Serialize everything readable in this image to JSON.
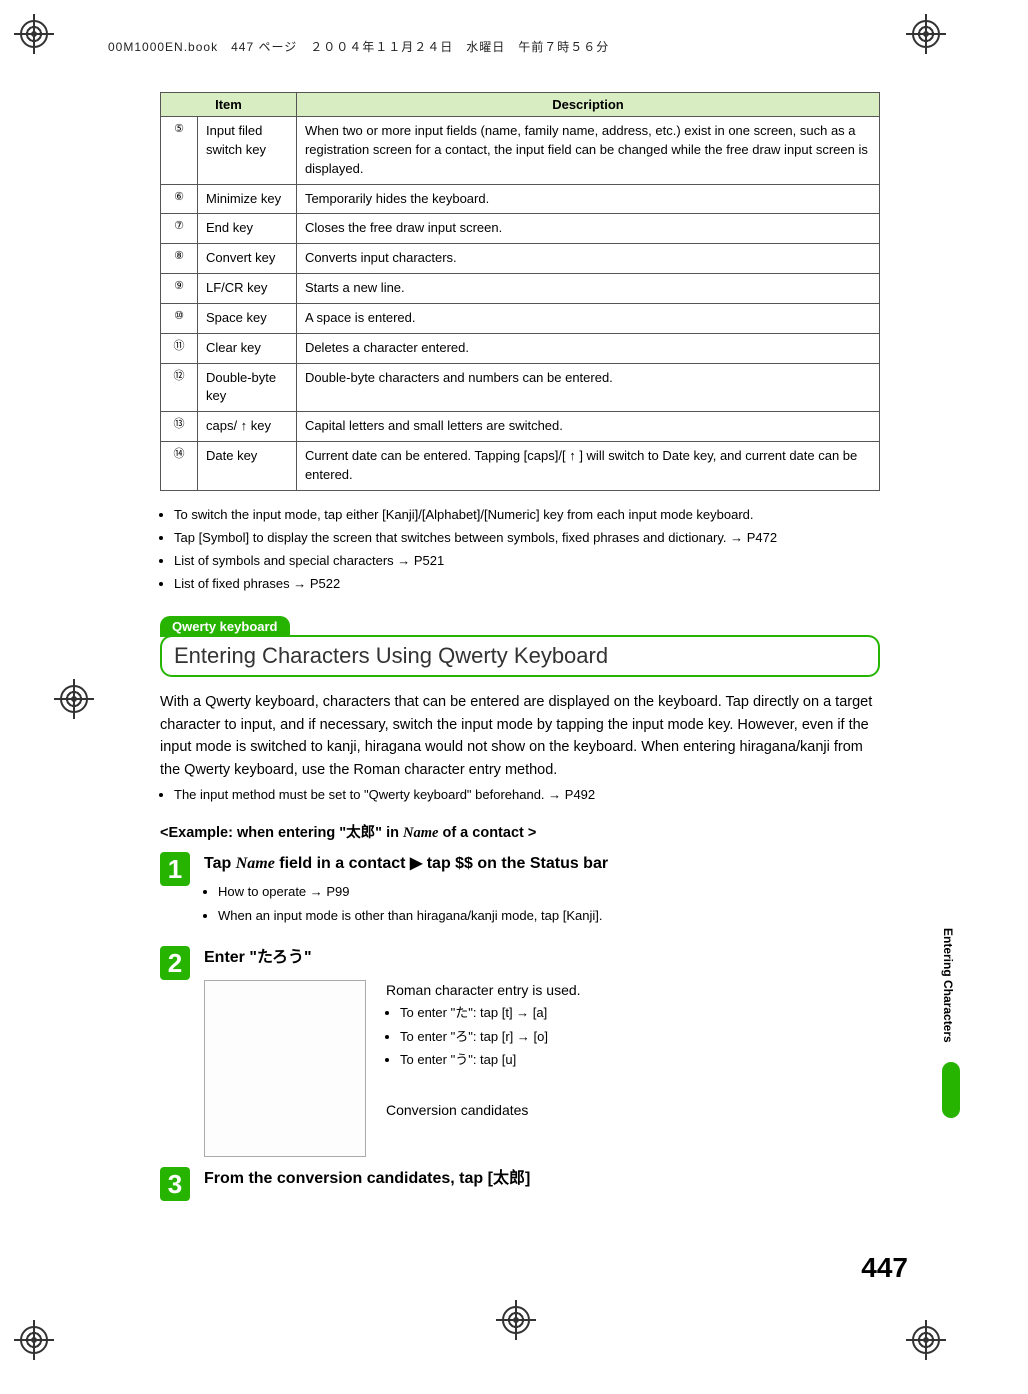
{
  "header": {
    "filename": "00M1000EN.book",
    "page_label": "447 ページ",
    "date": "２００４年１１月２４日",
    "weekday": "水曜日",
    "time": "午前７時５６分"
  },
  "table": {
    "headers": {
      "item": "Item",
      "description": "Description"
    },
    "rows": [
      {
        "num": "⑤",
        "item": "Input filed switch key",
        "desc": "When two or more input fields (name, family name, address, etc.) exist in one screen, such as a registration screen for a contact, the input field can be changed while the free draw input screen is displayed."
      },
      {
        "num": "⑥",
        "item": "Minimize key",
        "desc": "Temporarily hides the keyboard."
      },
      {
        "num": "⑦",
        "item": "End key",
        "desc": "Closes the free draw input screen."
      },
      {
        "num": "⑧",
        "item": "Convert key",
        "desc": "Converts input characters."
      },
      {
        "num": "⑨",
        "item": "LF/CR key",
        "desc": "Starts a new line."
      },
      {
        "num": "⑩",
        "item": "Space key",
        "desc": "A space is entered."
      },
      {
        "num": "⑪",
        "item": "Clear key",
        "desc": "Deletes a character entered."
      },
      {
        "num": "⑫",
        "item": "Double-byte key",
        "desc": "Double-byte characters and numbers can be entered."
      },
      {
        "num": "⑬",
        "item": "caps/ ↑ key",
        "desc": "Capital letters and small letters are switched."
      },
      {
        "num": "⑭",
        "item": "Date key",
        "desc": "Current date can be entered. Tapping [caps]/[ ↑ ] will switch to Date key, and current date can be entered."
      }
    ]
  },
  "notes": [
    "To switch the input mode, tap either [Kanji]/[Alphabet]/[Numeric] key from each input mode keyboard.",
    "Tap [Symbol] to display the screen that switches between symbols, fixed phrases and dictionary. → P472",
    "List of symbols and special characters → P521",
    "List of fixed phrases → P522"
  ],
  "section": {
    "pill": "Qwerty keyboard",
    "title": "Entering Characters Using Qwerty Keyboard",
    "body": "With a Qwerty keyboard, characters that can be entered are displayed on the keyboard. Tap directly on a target character to input, and if necessary, switch the input mode by tapping the input mode key. However, even if the input mode is switched to kanji, hiragana would not show on the keyboard. When entering hiragana/kanji from the Qwerty keyboard, use the Roman character entry method.",
    "precond": "The input method must be set to \"Qwerty keyboard\" beforehand. → P492"
  },
  "example": {
    "heading_prefix": "<Example: when entering \"",
    "heading_kanji": "太郎",
    "heading_mid": "\" in ",
    "heading_name": "Name",
    "heading_suffix": " of a contact >"
  },
  "steps": {
    "s1": {
      "num": "1",
      "title_pre": "Tap ",
      "title_name": "Name",
      "title_mid": " field in a contact ",
      "title_arrow": "▶",
      "title_post": " tap $$ on the Status bar",
      "b1": "How to operate → P99",
      "b2": "When an input mode is other than hiragana/kanji mode, tap [Kanji]."
    },
    "s2": {
      "num": "2",
      "title_pre": "Enter \"",
      "title_kana": "たろう",
      "title_post": "\"",
      "right_intro": "Roman character entry is used.",
      "r1": "To enter \"た\": tap [t] → [a]",
      "r2": "To enter \"ろ\": tap [r] → [o]",
      "r3": "To enter \"う\": tap [u]",
      "caption": "Conversion candidates"
    },
    "s3": {
      "num": "3",
      "title_pre": "From the conversion candidates, tap [",
      "title_kanji": "太郎",
      "title_post": "]"
    }
  },
  "side_tab": "Entering Characters",
  "page_number": "447"
}
